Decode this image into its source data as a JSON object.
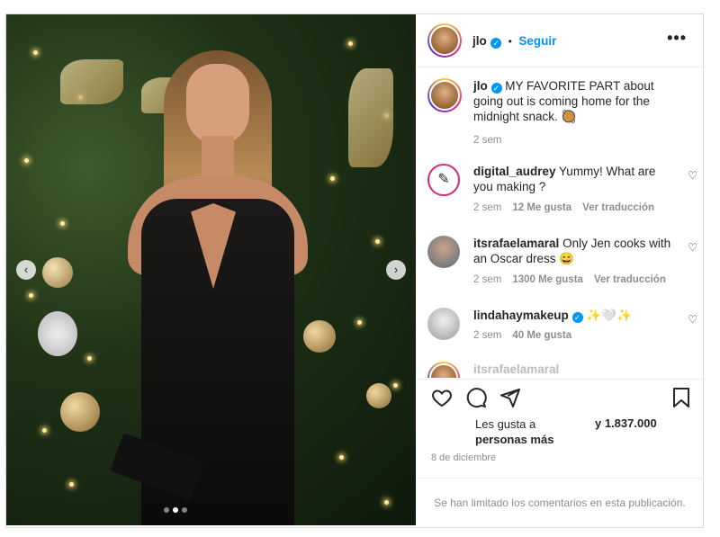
{
  "header": {
    "username": "jlo",
    "separator": "•",
    "follow_label": "Seguir",
    "more_icon": "more-horizontal-icon"
  },
  "caption": {
    "username": "jlo",
    "text": "MY FAVORITE PART about going out is coming home for the midnight snack. 🥘",
    "time": "2 sem"
  },
  "comments": [
    {
      "username": "digital_audrey",
      "text": "Yummy! What are you making ?",
      "time": "2 sem",
      "likes": "12 Me gusta",
      "translate": "Ver traducción"
    },
    {
      "username": "itsrafaelamaral",
      "text": "Only Jen cooks with an Oscar dress 😄",
      "time": "2 sem",
      "likes": "1300 Me gusta",
      "translate": "Ver traducción"
    },
    {
      "username": "lindahaymakeup",
      "text": "✨🤍✨",
      "time": "2 sem",
      "likes": "40 Me gusta"
    },
    {
      "username": "itsrafaelamaral",
      "text": "...",
      "time": ""
    }
  ],
  "actions": {
    "like_icon": "heart-icon",
    "comment_icon": "comment-icon",
    "share_icon": "share-icon",
    "save_icon": "bookmark-icon"
  },
  "likes": {
    "line1": "Les gusta a",
    "line2": "personas más",
    "count": "y 1.837.000"
  },
  "date": "8 de diciembre",
  "comments_limited": "Se han limitado los comentarios en esta publicación.",
  "media": {
    "prev_icon": "chevron-left-icon",
    "next_icon": "chevron-right-icon",
    "description_colors": {
      "tree": "#1f3217",
      "dress": "#111111",
      "accent": "#0095f6"
    }
  }
}
